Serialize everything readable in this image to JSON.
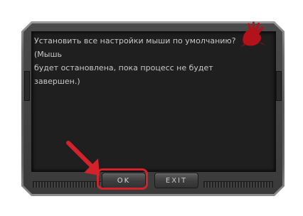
{
  "dialog": {
    "message_line1": "Установить все настройки мыши по умолчанию? (Мышь",
    "message_line2": "будет остановлена, пока процесс не будет завершен.)"
  },
  "buttons": {
    "ok_label": "OK",
    "exit_label": "EXIT"
  },
  "icons": {
    "logo": "bloody-hand-logo",
    "annotation_arrow": "red-arrow-icon"
  },
  "colors": {
    "accent_red": "#d3222c",
    "panel_bg": "#1f1f1f",
    "text": "#c8c8c8"
  }
}
